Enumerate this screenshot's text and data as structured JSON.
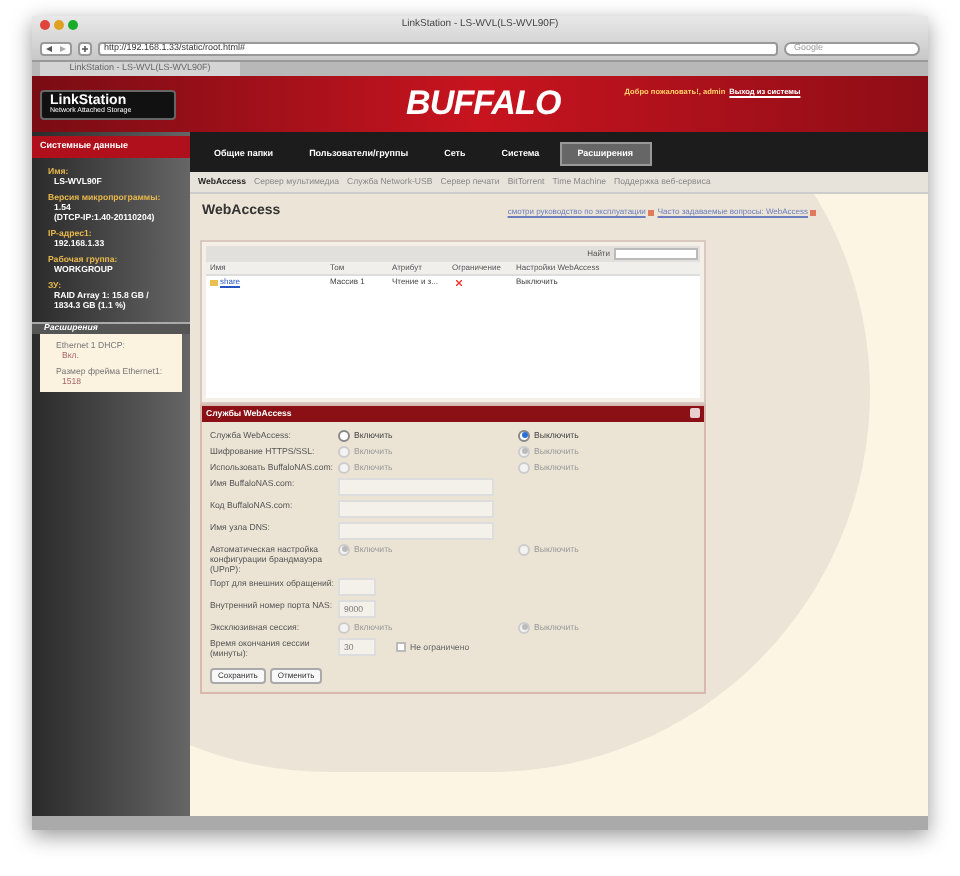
{
  "window": {
    "title": "LinkStation - LS-WVL(LS-WVL90F)"
  },
  "toolbar": {
    "url": "http://192.168.1.33/static/root.html#",
    "search_placeholder": "Google"
  },
  "browser_tabs": [
    {
      "label": "LinkStation - LS-WVL(LS-WVL90F)",
      "selected": true
    }
  ],
  "header": {
    "logo_title": "LinkStation",
    "logo_subtitle": "Network Attached Storage",
    "brand": "BUFFALO",
    "welcome": "Добро пожаловать!, admin",
    "logout": "Выход из системы"
  },
  "sidebar": {
    "title": "Системные данные",
    "items": [
      {
        "label": "Имя:",
        "lines": [
          "LS-WVL90F"
        ]
      },
      {
        "label": "Версия микропрограммы:",
        "lines": [
          "1.54",
          "(DTCP-IP:1.40-20110204)"
        ]
      },
      {
        "label": "IP-адрес1:",
        "lines": [
          "192.168.1.33"
        ]
      },
      {
        "label": "Рабочая группа:",
        "lines": [
          "WORKGROUP"
        ]
      },
      {
        "label": "ЗУ:",
        "lines": [
          "RAID Array 1: 15.8 GB /",
          "1834.3 GB (1.1 %)"
        ]
      }
    ],
    "extensions_title": "Расширения",
    "extensions": [
      {
        "label": "Ethernet 1 DHCP:",
        "value": "Вкл."
      },
      {
        "label": "Размер фрейма Ethernet1:",
        "value": "1518"
      }
    ]
  },
  "nav": [
    {
      "label": "Общие папки",
      "selected": false
    },
    {
      "label": "Пользователи/группы",
      "selected": false
    },
    {
      "label": "Сеть",
      "selected": false
    },
    {
      "label": "Система",
      "selected": false
    },
    {
      "label": "Расширения",
      "selected": true
    }
  ],
  "subnav": [
    {
      "label": "WebAccess",
      "selected": true
    },
    {
      "label": "Сервер мультимедиа",
      "selected": false
    },
    {
      "label": "Служба Network-USB",
      "selected": false
    },
    {
      "label": "Сервер печати",
      "selected": false
    },
    {
      "label": "BitTorrent",
      "selected": false
    },
    {
      "label": "Time Machine",
      "selected": false
    },
    {
      "label": "Поддержка веб-сервиса",
      "selected": false
    }
  ],
  "page": {
    "title": "WebAccess",
    "links": [
      "смотри руководство по эксплуатации",
      "Часто задаваемые вопросы: WebAccess"
    ]
  },
  "table": {
    "search_label": "Найти",
    "columns": [
      "Имя",
      "Том",
      "Атрибут",
      "Ограничение",
      "Настройки WebAccess"
    ],
    "rows": [
      {
        "name": "share",
        "volume": "Массив 1",
        "attribute": "Чтение и з...",
        "restricted": false,
        "webaccess": "Выключить"
      }
    ]
  },
  "form": {
    "title": "Службы WebAccess",
    "rows": [
      {
        "kind": "radio",
        "label": "Служба WebAccess:",
        "disabled": false,
        "options": [
          {
            "label": "Включить",
            "selected": false
          },
          {
            "label": "Выключить",
            "selected": true
          }
        ]
      },
      {
        "kind": "radio",
        "label": "Шифрование HTTPS/SSL:",
        "disabled": true,
        "options": [
          {
            "label": "Включить",
            "selected": false
          },
          {
            "label": "Выключить",
            "selected": true
          }
        ]
      },
      {
        "kind": "radio",
        "label": "Использовать BuffaloNAS.com:",
        "disabled": true,
        "options": [
          {
            "label": "Включить",
            "selected": false
          },
          {
            "label": "Выключить",
            "selected": false
          }
        ]
      },
      {
        "kind": "field",
        "label": "Имя BuffaloNAS.com:",
        "disabled": true
      },
      {
        "kind": "field",
        "label": "Код BuffaloNAS.com:",
        "disabled": true
      },
      {
        "kind": "field",
        "label": "Имя узла DNS:",
        "disabled": true
      },
      {
        "kind": "radio",
        "label": "Автоматическая настройка конфигурации брандмауэра (UPnP):",
        "disabled": true,
        "options": [
          {
            "label": "Включить",
            "selected": true
          },
          {
            "label": "Выключить",
            "selected": false
          }
        ]
      },
      {
        "kind": "short_field",
        "label": "Порт для внешних обращений:",
        "disabled": true
      },
      {
        "kind": "short_field",
        "label": "Внутренний номер порта NAS:",
        "disabled": true,
        "value": "9000"
      },
      {
        "kind": "radio",
        "label": "Эксклюзивная сессия:",
        "disabled": true,
        "options": [
          {
            "label": "Включить",
            "selected": false
          },
          {
            "label": "Выключить",
            "selected": true
          }
        ]
      },
      {
        "kind": "field_check",
        "label": "Время окончания сессии (минуты):",
        "disabled": true,
        "value": "30",
        "check_label": "Не ограничено",
        "checked": false
      }
    ],
    "buttons": [
      "Сохранить",
      "Отменить"
    ]
  }
}
